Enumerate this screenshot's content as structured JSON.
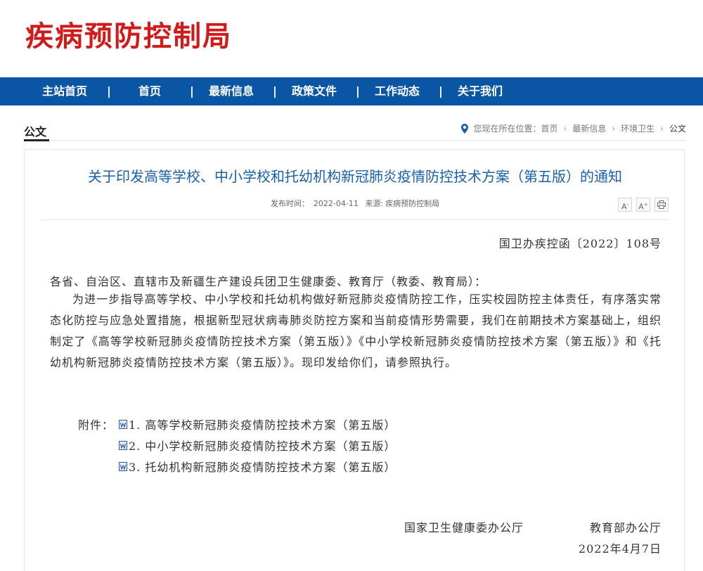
{
  "header": {
    "site_title": "疾病预防控制局"
  },
  "nav": {
    "items": [
      "主站首页",
      "首页",
      "最新信息",
      "政策文件",
      "工作动态",
      "关于我们"
    ],
    "separator": "|"
  },
  "section": {
    "title": "公文"
  },
  "breadcrumb": {
    "prefix": "您现在所在位置：",
    "items": [
      "首页",
      "最新信息",
      "环境卫生",
      "公文"
    ],
    "arrow": "›"
  },
  "article": {
    "title": "关于印发高等学校、中小学校和托幼机构新冠肺炎疫情防控技术方案（第五版）的通知",
    "meta": {
      "date_label": "发布时间：",
      "date": "2022-04-11",
      "source_label": "来源:",
      "source": "疾病预防控制局"
    },
    "tools": {
      "font_smaller": "A-",
      "font_larger": "A+",
      "print": "print"
    },
    "doc_number": "国卫办疾控函〔2022〕108号",
    "salutation": "各省、自治区、直辖市及新疆生产建设兵团卫生健康委、教育厅（教委、教育局）：",
    "paragraph": "为进一步指导高等学校、中小学校和托幼机构做好新冠肺炎疫情防控工作，压实校园防控主体责任，有序落实常态化防控与应急处置措施，根据新型冠状病毒肺炎防控方案和当前疫情形势需要，我们在前期技术方案基础上，组织制定了《高等学校新冠肺炎疫情防控技术方案（第五版）》《中小学校新冠肺炎疫情防控技术方案（第五版）》和《托幼机构新冠肺炎疫情防控技术方案（第五版）》。现印发给你们，请参照执行。",
    "attachments_label": "附件：",
    "attachments": [
      "1. 高等学校新冠肺炎疫情防控技术方案（第五版）",
      "2. 中小学校新冠肺炎疫情防控技术方案（第五版）",
      "3. 托幼机构新冠肺炎疫情防控技术方案（第五版）"
    ],
    "signatories": [
      "国家卫生健康委办公厅",
      "教育部办公厅"
    ],
    "sign_date": "2022年4月7日"
  },
  "colors": {
    "brand_red": "#d11a1a",
    "nav_blue": "#0b56a4",
    "title_blue": "#1a5fa8"
  },
  "icons": {
    "breadcrumb": "location-pin-icon",
    "attachment": "word-doc-icon",
    "print": "printer-icon"
  }
}
